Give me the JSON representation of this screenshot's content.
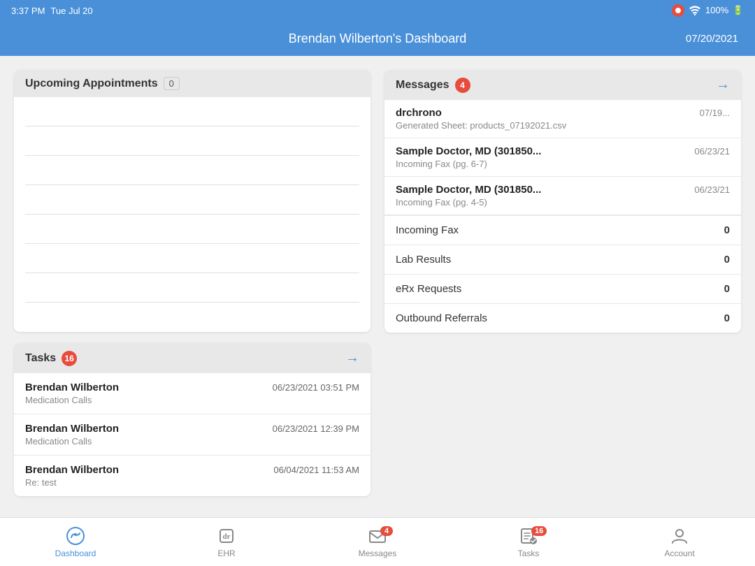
{
  "statusBar": {
    "time": "3:37 PM",
    "day": "Tue Jul 20",
    "battery": "100%"
  },
  "header": {
    "title": "Brendan Wilberton's Dashboard",
    "date": "07/20/2021"
  },
  "appointments": {
    "title": "Upcoming Appointments",
    "count": "0",
    "emptyRows": 8
  },
  "messages": {
    "title": "Messages",
    "count": "4",
    "items": [
      {
        "sender": "drchrono",
        "date": "07/19...",
        "subject": "Generated Sheet: products_07192021.csv"
      },
      {
        "sender": "Sample Doctor, MD (301850...",
        "date": "06/23/21",
        "subject": "Incoming Fax (pg. 6-7)"
      },
      {
        "sender": "Sample Doctor, MD (301850...",
        "date": "06/23/21",
        "subject": "Incoming Fax (pg. 4-5)"
      }
    ],
    "stats": [
      {
        "label": "Incoming Fax",
        "value": "0"
      },
      {
        "label": "Lab Results",
        "value": "0"
      },
      {
        "label": "eRx Requests",
        "value": "0"
      },
      {
        "label": "Outbound Referrals",
        "value": "0"
      }
    ]
  },
  "tasks": {
    "title": "Tasks",
    "count": "16",
    "items": [
      {
        "name": "Brendan Wilberton",
        "date": "06/23/2021 03:51 PM",
        "subject": "Medication Calls"
      },
      {
        "name": "Brendan Wilberton",
        "date": "06/23/2021 12:39 PM",
        "subject": "Medication Calls"
      },
      {
        "name": "Brendan Wilberton",
        "date": "06/04/2021 11:53 AM",
        "subject": "Re: test"
      }
    ]
  },
  "tabBar": {
    "tabs": [
      {
        "id": "dashboard",
        "label": "Dashboard",
        "active": true,
        "badge": null
      },
      {
        "id": "ehr",
        "label": "EHR",
        "active": false,
        "badge": null
      },
      {
        "id": "messages",
        "label": "Messages",
        "active": false,
        "badge": "4"
      },
      {
        "id": "tasks",
        "label": "Tasks",
        "active": false,
        "badge": "16"
      },
      {
        "id": "account",
        "label": "Account",
        "active": false,
        "badge": null
      }
    ]
  }
}
